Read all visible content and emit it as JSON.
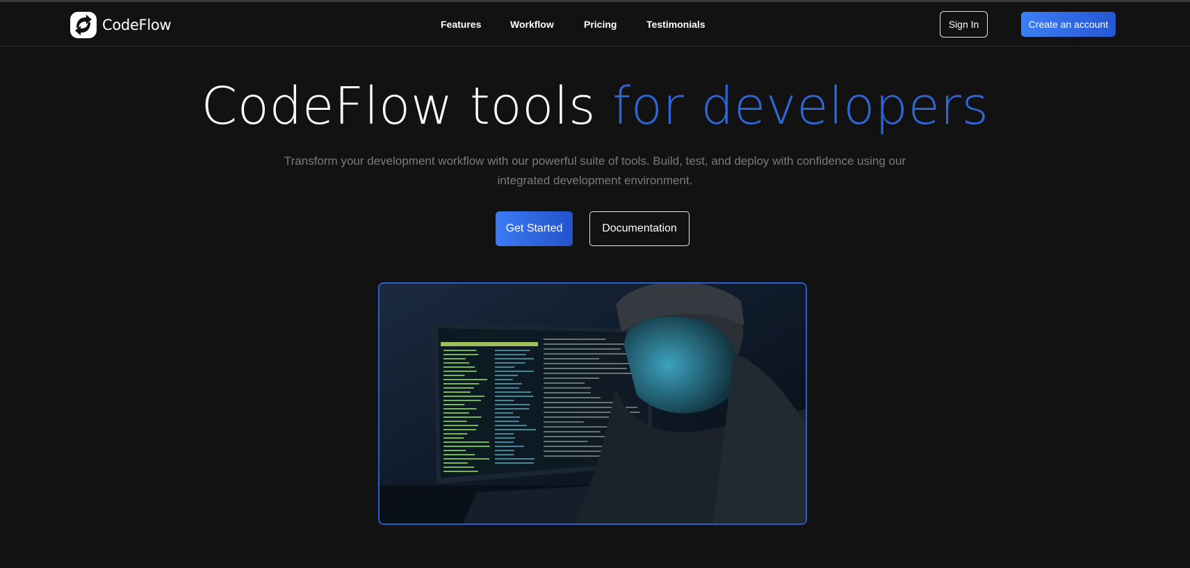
{
  "brand": {
    "name": "CodeFlow",
    "accent_color": "#2f66d6",
    "logo_icon": "sync-arrows-icon"
  },
  "nav": {
    "links": [
      "Features",
      "Workflow",
      "Pricing",
      "Testimonials"
    ],
    "sign_in": "Sign In",
    "create_account": "Create an account"
  },
  "hero": {
    "title_main": "CodeFlow tools",
    "title_accent": "for developers",
    "subtitle": "Transform your development workflow with our powerful suite of tools. Build, test, and deploy with confidence using our integrated development environment.",
    "primary_cta": "Get Started",
    "secondary_cta": "Documentation",
    "image_subject": "developer in hooded sweatshirt and beanie looking at a monitor full of green terminal code"
  }
}
